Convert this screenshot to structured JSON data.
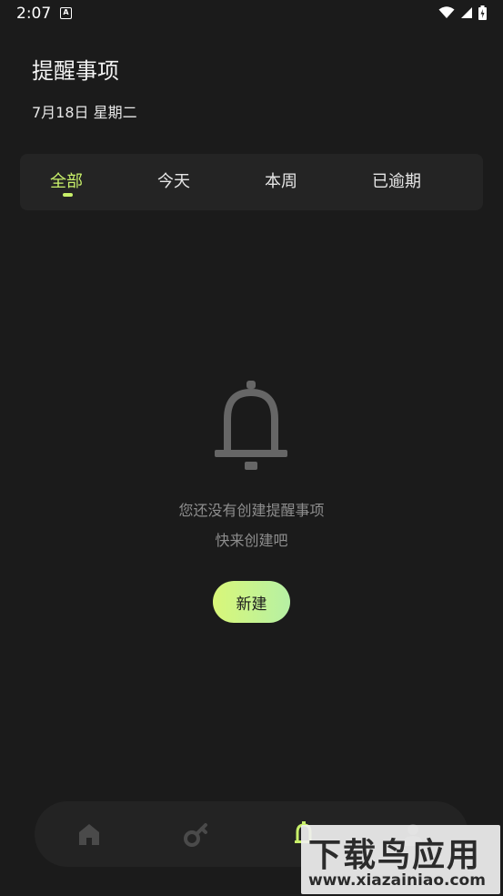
{
  "status_bar": {
    "time": "2:07",
    "notif_letter": "A"
  },
  "header": {
    "title": "提醒事项",
    "date": "7月18日 星期二"
  },
  "tabs": [
    {
      "label": "全部",
      "active": true
    },
    {
      "label": "今天",
      "active": false
    },
    {
      "label": "本周",
      "active": false
    },
    {
      "label": "已逾期",
      "active": false
    }
  ],
  "empty_state": {
    "line1": "您还没有创建提醒事项",
    "line2": "快来创建吧",
    "button_label": "新建"
  },
  "bottom_nav": {
    "items": [
      "home-icon",
      "key-icon",
      "bell-icon",
      "profile-icon"
    ],
    "active": "bell-icon"
  },
  "watermark": {
    "text": "下载鸟应用",
    "url": "www.xiazainiao.com"
  },
  "colors": {
    "background": "#1b1b1b",
    "accent": "#c8f06a",
    "surface": "#242424",
    "muted_text": "#8d8d8d"
  }
}
